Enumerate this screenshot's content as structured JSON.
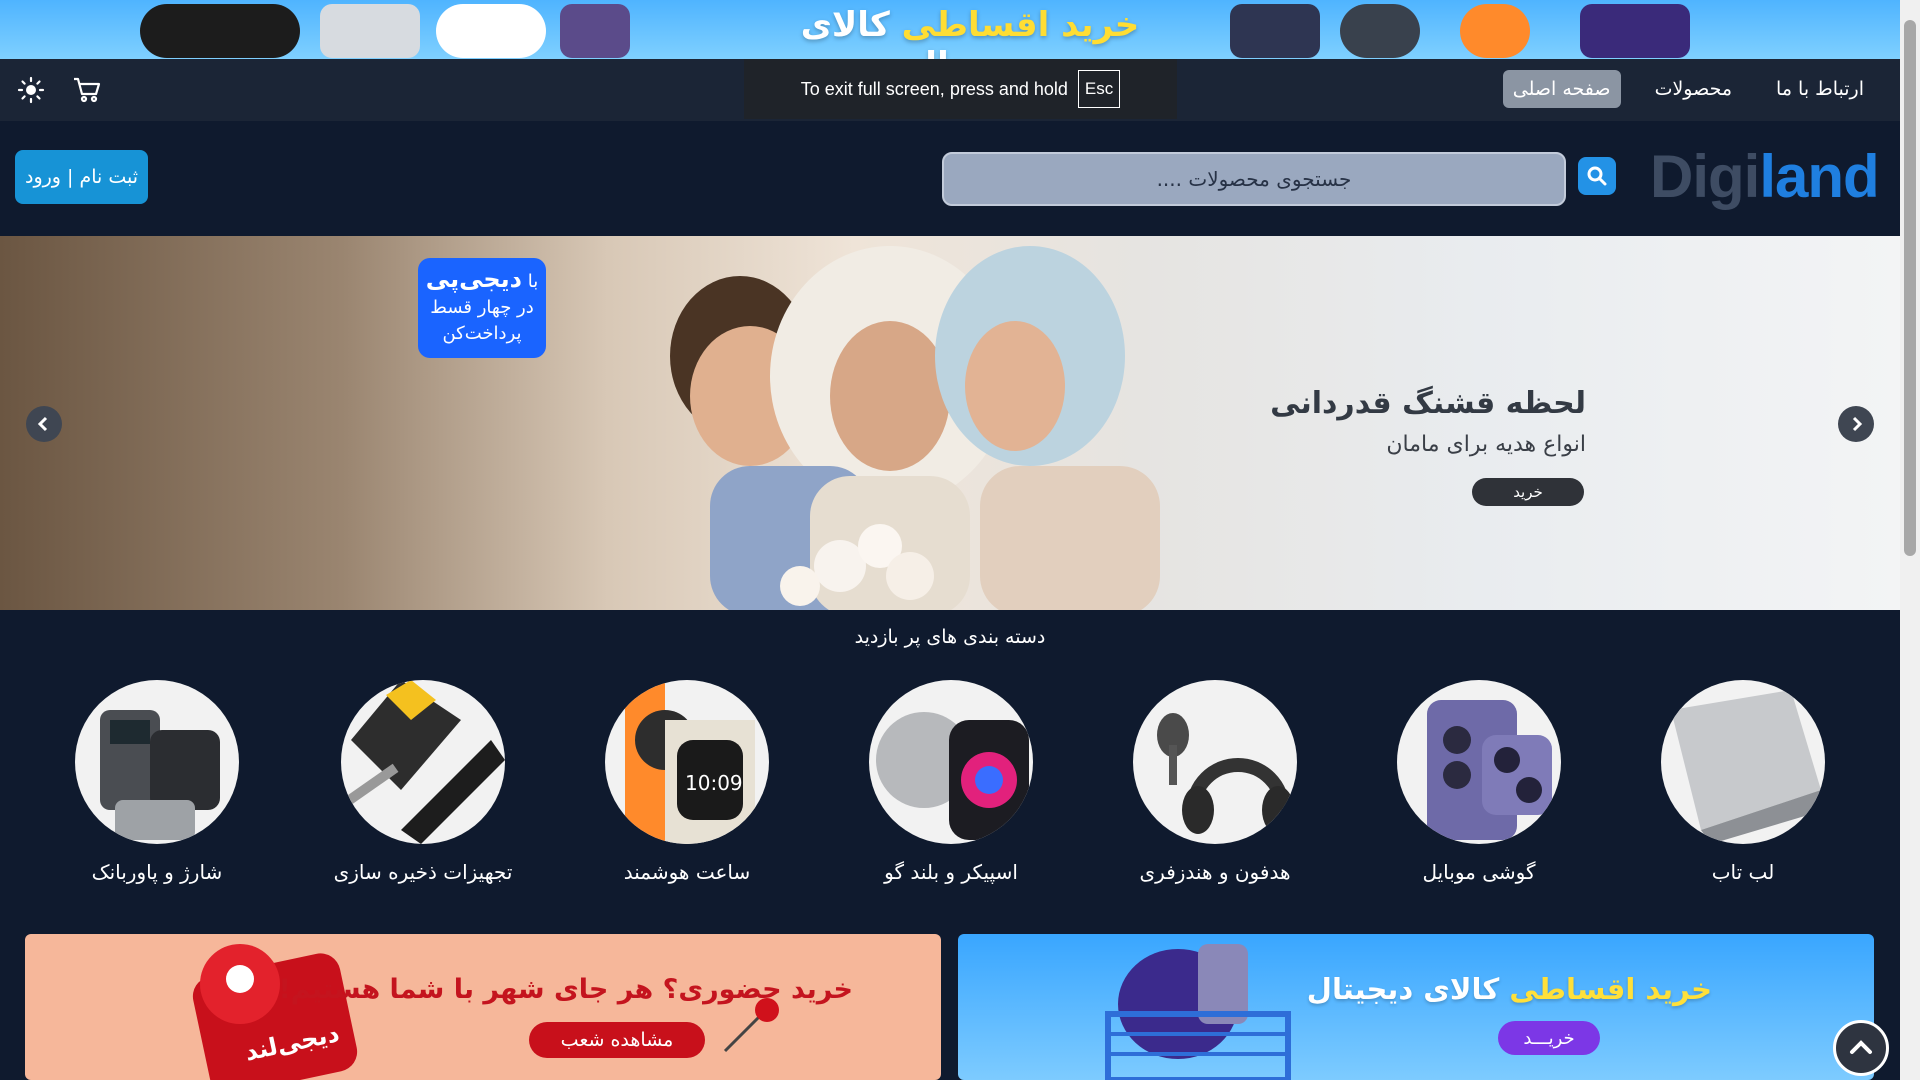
{
  "promo_top": {
    "text_main": "خرید اقساطی",
    "text_rest": " کالای دیجیتال"
  },
  "nav": {
    "links": [
      {
        "label": "صفحه اصلی",
        "active": true
      },
      {
        "label": "محصولات",
        "active": false
      },
      {
        "label": "ارتباط با ما",
        "active": false
      }
    ],
    "theme_icon": "sun-icon",
    "cart_icon": "cart-icon"
  },
  "fullscreen_notice": {
    "text": "To exit full screen, press and hold",
    "key": "Esc"
  },
  "header": {
    "login_label": "ثبت نام | ورود",
    "search_placeholder": "جستجوی محصولات ....",
    "logo_part1": "Digi",
    "logo_part2": "land"
  },
  "hero": {
    "badge_prefix": "با",
    "badge_brand": "دیجی‌پی",
    "badge_line2": "در چهار قسط",
    "badge_line3": "پرداخت‌کن",
    "title": "لحظه قشنگ قدردانی",
    "subtitle": "انواع هدیه برای مامان",
    "button": "خرید"
  },
  "categories": {
    "title": "دسته بندی های پر بازدید",
    "items": [
      {
        "label": "لب تاب",
        "icon": "laptop-icon"
      },
      {
        "label": "گوشی موبایل",
        "icon": "phone-icon"
      },
      {
        "label": "هدفون و هندزفری",
        "icon": "headphone-icon"
      },
      {
        "label": "اسپیکر و بلند گو",
        "icon": "speaker-icon"
      },
      {
        "label": "ساعت هوشمند",
        "icon": "smartwatch-icon"
      },
      {
        "label": "تجهیزات ذخیره سازی",
        "icon": "storage-icon"
      },
      {
        "label": "شارژ و پاوربانک",
        "icon": "charger-icon"
      }
    ]
  },
  "banners": {
    "store": {
      "title": "خرید حضوری؟ هر جای شهر با شما هستیم!",
      "button": "مشاهده شعب",
      "logo_text": "دیجی‌لند"
    },
    "installment": {
      "title_hl": "خرید اقساطی",
      "title_rest": " کالای دیجیتال",
      "button": "خریـــد"
    }
  }
}
